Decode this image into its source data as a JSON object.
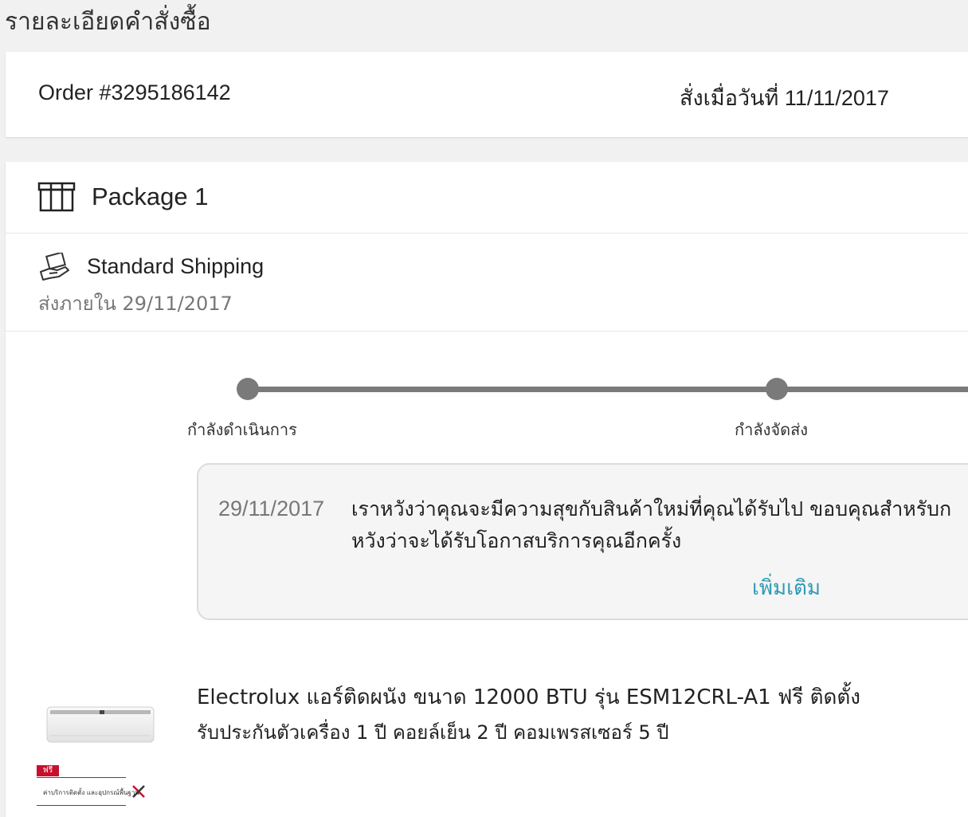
{
  "page": {
    "title": "รายละเอียดคำสั่งซื้อ"
  },
  "order": {
    "number": "Order #3295186142",
    "date": "สั่งเมื่อวันที่ 11/11/2017"
  },
  "package": {
    "title": "Package 1",
    "shipping_method": "Standard Shipping",
    "shipping_eta": "ส่งภายใน 29/11/2017",
    "tracking": {
      "steps": [
        {
          "label": "กำลังดำเนินการ"
        },
        {
          "label": "กำลังจัดส่ง"
        }
      ]
    },
    "note": {
      "date": "29/11/2017",
      "line1": "เราหวังว่าคุณจะมีความสุขกับสินค้าใหม่ที่คุณได้รับไป ขอบคุณสำหรับก",
      "line2": "หวังว่าจะได้รับโอกาสบริการคุณอีกครั้ง",
      "more_label": "เพิ่มเติม"
    },
    "product": {
      "name_line1": "Electrolux แอร์ติดผนัง ขนาด 12000 BTU รุ่น ESM12CRL-A1 ฟรี ติดตั้ง",
      "name_line2": "รับประกันตัวเครื่อง 1 ปี คอยล์เย็น 2 ปี คอมเพรสเซอร์ 5 ปี",
      "promo_tag": "ฟรี",
      "promo_text": "ค่าบริการติดตั้ง และอุปกรณ์พื้นฐาน"
    }
  },
  "colors": {
    "accent_link": "#2e9ab3",
    "track": "#7a7a7a",
    "promo_red": "#c8102e"
  }
}
